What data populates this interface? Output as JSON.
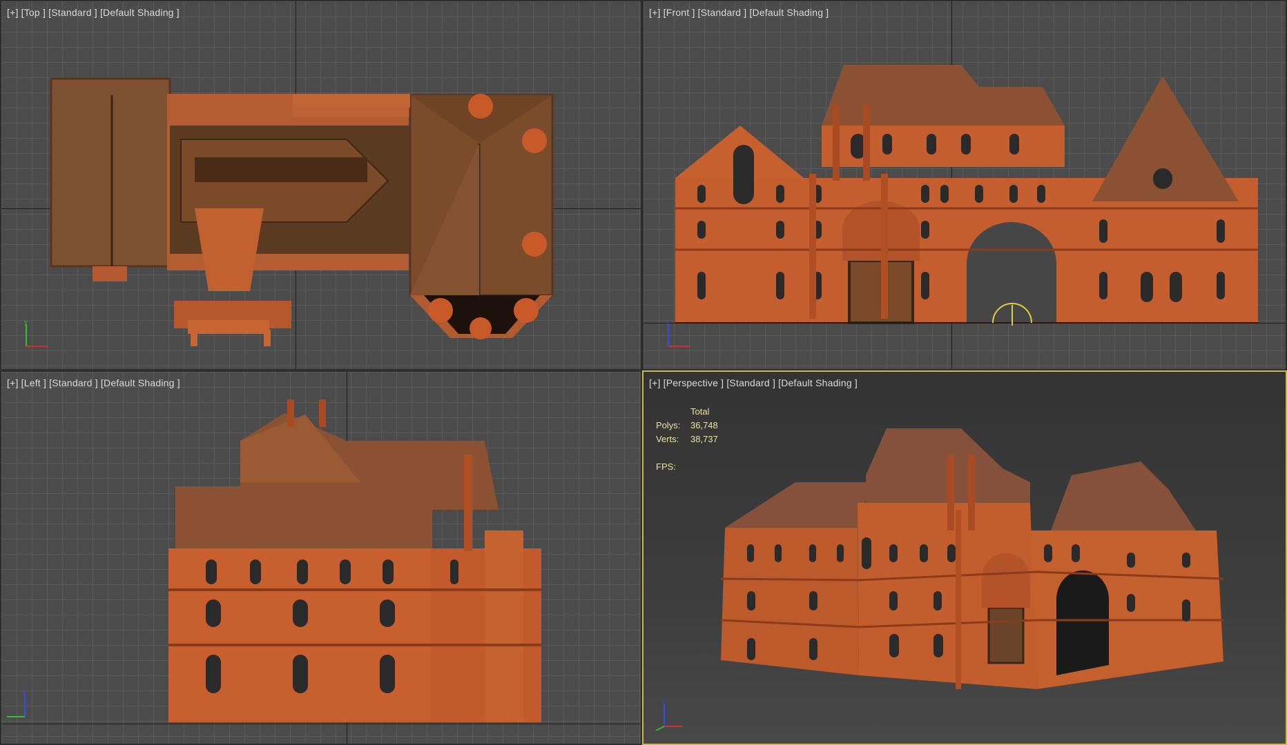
{
  "viewports": {
    "top": {
      "label": "[+] [Top ] [Standard ] [Default Shading ]"
    },
    "front": {
      "label": "[+] [Front ] [Standard ] [Default Shading ]"
    },
    "left": {
      "label": "[+] [Left ] [Standard ] [Default Shading ]"
    },
    "perspective": {
      "label": "[+] [Perspective ] [Standard ] [Default Shading ]",
      "active": true,
      "stats": {
        "header": "Total",
        "polys_label": "Polys:",
        "polys_value": "36,748",
        "verts_label": "Verts:",
        "verts_value": "38,737",
        "fps_label": "FPS:"
      }
    }
  },
  "colors": {
    "active_border": "#c9b84a",
    "grid_bg": "#4b4b4b",
    "grid_line": "#5a5a5a",
    "brick": "#c0582c",
    "roof": "#7a4a2c",
    "axis_x": "#d03030",
    "axis_y": "#30c030",
    "axis_z": "#3050e0"
  }
}
